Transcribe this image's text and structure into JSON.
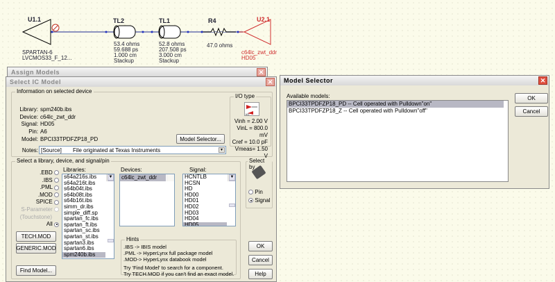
{
  "schematic": {
    "u1": {
      "ref": "U1.1",
      "line1": "SPARTAN-6",
      "line2": "LVCMOS33_F_12..."
    },
    "tl2": {
      "ref": "TL2",
      "params": [
        "53.4 ohms",
        "59.688 ps",
        "1.000 cm",
        "Stackup"
      ]
    },
    "tl1": {
      "ref": "TL1",
      "params": [
        "52.8 ohms",
        "207.508 ps",
        "3.000 cm",
        "Stackup"
      ]
    },
    "r4": {
      "ref": "R4",
      "value": "47.0 ohms"
    },
    "u2": {
      "ref": "U2.1",
      "line1": "c64lc_zwt_ddr",
      "line2": "HD05"
    },
    "colors": {
      "wire": "#6870b0",
      "receiver": "#d03030"
    }
  },
  "assign_models": {
    "title": "Assign Models"
  },
  "select_ic": {
    "title": "Select IC Model",
    "info_group": "Information on selected device",
    "fields": [
      {
        "label": "Library:",
        "value": "spm240b.ibs"
      },
      {
        "label": "Device:",
        "value": "c64lc_zwt_ddr"
      },
      {
        "label": "Signal:",
        "value": "HD05"
      },
      {
        "label": "Pin:",
        "value": "A6"
      },
      {
        "label": "Model:",
        "value": "BPCI33TPDFZP18_PD"
      }
    ],
    "model_selector_button": "Model Selector...",
    "notes_label": "Notes:",
    "notes_tag": "[Source]",
    "notes_value": "File originated at Texas Instruments",
    "io_type": {
      "title": "I/O type",
      "icon_label": "I/O",
      "vinh": "Vinh = 2.00 V",
      "vinl": "VinL = 800.0 mV",
      "cref": "Cref = 10.0 pF",
      "vmeas": "Vmeas= 1.50 V"
    },
    "select_group": "Select a library, device, and signal/pin",
    "types": [
      {
        "label": ".EBD",
        "on": false
      },
      {
        "label": ".IBS",
        "on": false
      },
      {
        "label": ".PML",
        "on": false
      },
      {
        "label": ".MOD",
        "on": false
      },
      {
        "label": "SPICE",
        "on": false
      },
      {
        "label": "S-Parameter",
        "label2": "(Touchstone)",
        "on": false,
        "disabled": true
      },
      {
        "label": "All",
        "on": true
      }
    ],
    "libraries_label": "Libraries:",
    "libraries": [
      "s64a216s.ibs",
      "s64a216t.ibs",
      "s64b04t.ibs",
      "s64b08t.ibs",
      "s64b16t.ibs",
      "simm_dr.ibs",
      "simple_diff.sp",
      "spartan_fc.ibs",
      "spartan_ft.ibs",
      "spartan_sc.ibs",
      "spartan_st.ibs",
      "spartan3.ibs",
      "spartan6.ibs",
      "spm240b.ibs"
    ],
    "devices_label": "Devices:",
    "devices": [
      "c64lc_zwt_ddr"
    ],
    "signal_label": "Signal:",
    "signals": [
      "HCNTLB",
      "HCSN",
      "HD",
      "HD00",
      "HD01",
      "HD02",
      "HD03",
      "HD04",
      "HD05"
    ],
    "tech_mod": "TECH.MOD",
    "generic_mod": "GENERIC.MOD",
    "find_model": "Find Model...",
    "hints": {
      "title": "Hints",
      "lines": [
        ".IBS   -> IBIS model",
        ".PML -> HyperLynx full package model",
        ".MOD-> HyperLynx databook model"
      ],
      "tip1": "Try 'Find Model' to search for a component.",
      "tip2": "Try TECH.MOD if you can't find an exact model."
    },
    "select_by": {
      "title": "Select by",
      "pin": "Pin",
      "signal": "Signal",
      "selected": "Signal"
    },
    "ok": "OK",
    "cancel": "Cancel",
    "help": "Help"
  },
  "model_selector": {
    "title": "Model Selector",
    "available_label": "Available models:",
    "models": [
      "BPCI33TPDFZP18_PD -- Cell operated with Pulldown\"on\"",
      "BPCI33TPDFZP18_Z -- Cell operated with Pulldown\"off\""
    ],
    "ok": "OK",
    "cancel": "Cancel"
  }
}
